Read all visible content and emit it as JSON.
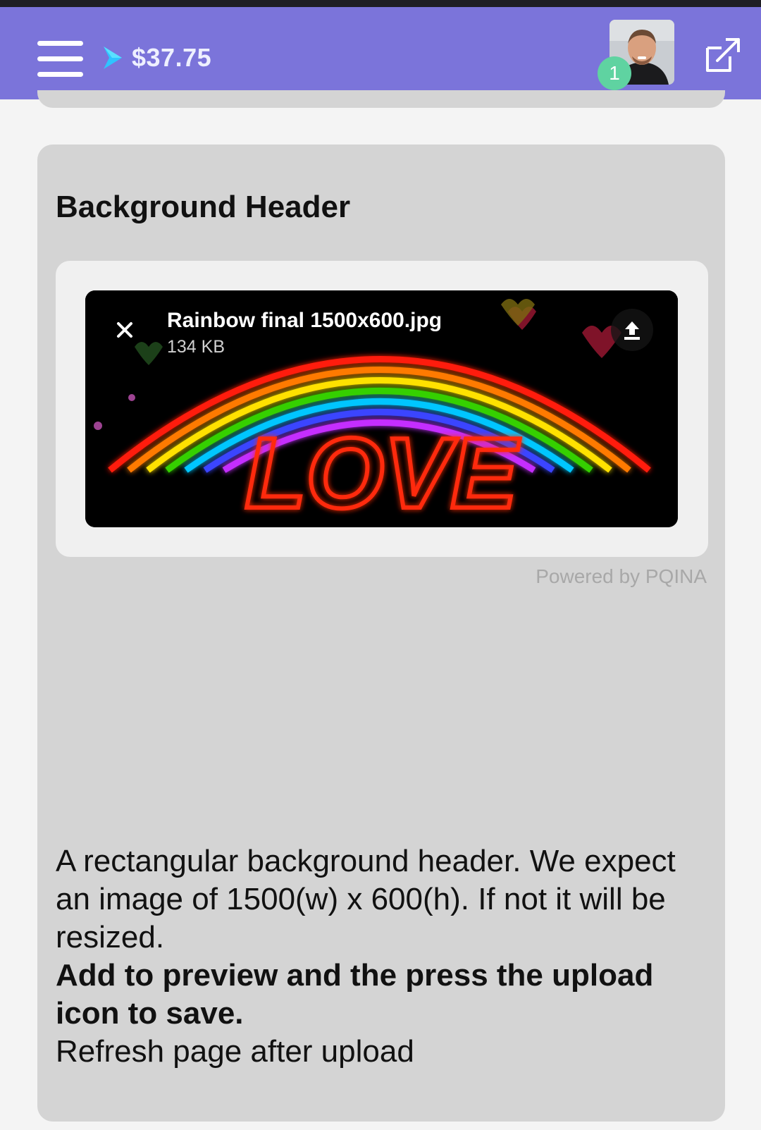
{
  "header": {
    "balance": "$37.75",
    "notification_count": "1"
  },
  "section": {
    "title": "Background Header",
    "file": {
      "name": "Rainbow final 1500x600.jpg",
      "size": "134 KB",
      "image_text": "LOVE"
    },
    "powered_by": "Powered by PQINA",
    "description": "A rectangular background header. We expect an image of 1500(w) x 600(h). If not it will be resized.",
    "instruction": "Add to preview and the press the upload icon to save.",
    "note": "Refresh page after upload"
  },
  "colors": {
    "topbar": "#7b74da",
    "badge": "#5fd3a1",
    "card": "#d4d4d4",
    "page": "#f4f4f4"
  },
  "icons": [
    "menu-icon",
    "arrow-right-icon",
    "external-link-icon",
    "close-icon",
    "upload-icon"
  ]
}
